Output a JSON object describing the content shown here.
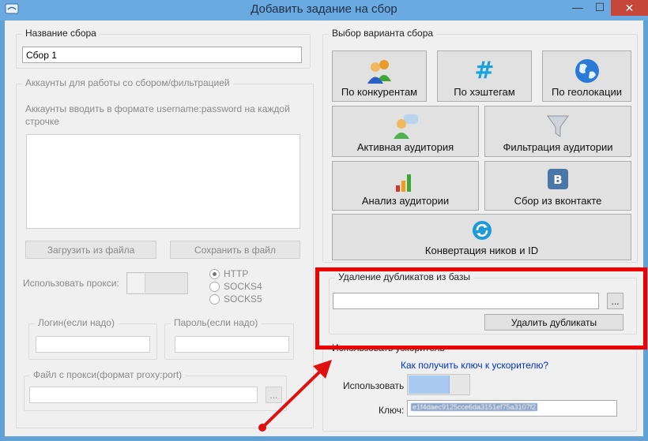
{
  "window": {
    "title": "Добавить задание на сбор",
    "minimize_glyph": "—",
    "maximize_glyph": "☐",
    "close_glyph": "✕"
  },
  "left": {
    "collection_name_legend": "Название сбора",
    "collection_name_value": "Сбор 1",
    "accounts": {
      "legend": "Аккаунты для работы со сбором/фильтрацией",
      "hint": "Аккаунты вводить в формате username:password на каждой строчке",
      "load_button": "Загрузить из файла",
      "save_button": "Сохранить в файл"
    },
    "proxy": {
      "use_label": "Использовать прокси:",
      "options": [
        "HTTP",
        "SOCKS4",
        "SOCKS5"
      ],
      "selected": "HTTP",
      "login_legend": "Логин(если надо)",
      "password_legend": "Пароль(если надо)",
      "file_legend": "Файл с прокси(формат proxy:port)",
      "browse_button": "..."
    }
  },
  "right": {
    "variant_legend": "Выбор варианта сбора",
    "buttons": {
      "competitors": "По конкурентам",
      "hashtags": "По хэштегам",
      "geo": "По геолокации",
      "active_audience": "Активная аудитория",
      "filter_audience": "Фильтрация аудитории",
      "analyze_audience": "Анализ аудитории",
      "vk": "Сбор из вконтакте",
      "convert": "Конвертация ников и ID"
    },
    "dedupe": {
      "legend": "Удаление дубликатов из базы",
      "browse_button": "...",
      "delete_button": "Удалить дубликаты"
    },
    "accelerator": {
      "legend": "Использовать ускоритель",
      "link": "Как получить ключ к ускорителю?",
      "use_label": "Использовать",
      "key_label": "Ключ:",
      "key_value": "e1f4daec9125cce6da3151ef75a3107f2"
    }
  },
  "colors": {
    "accent_red": "#ee0000",
    "titlebar": "#6aaae0",
    "close_button": "#c7463a",
    "link": "#0033cc"
  }
}
